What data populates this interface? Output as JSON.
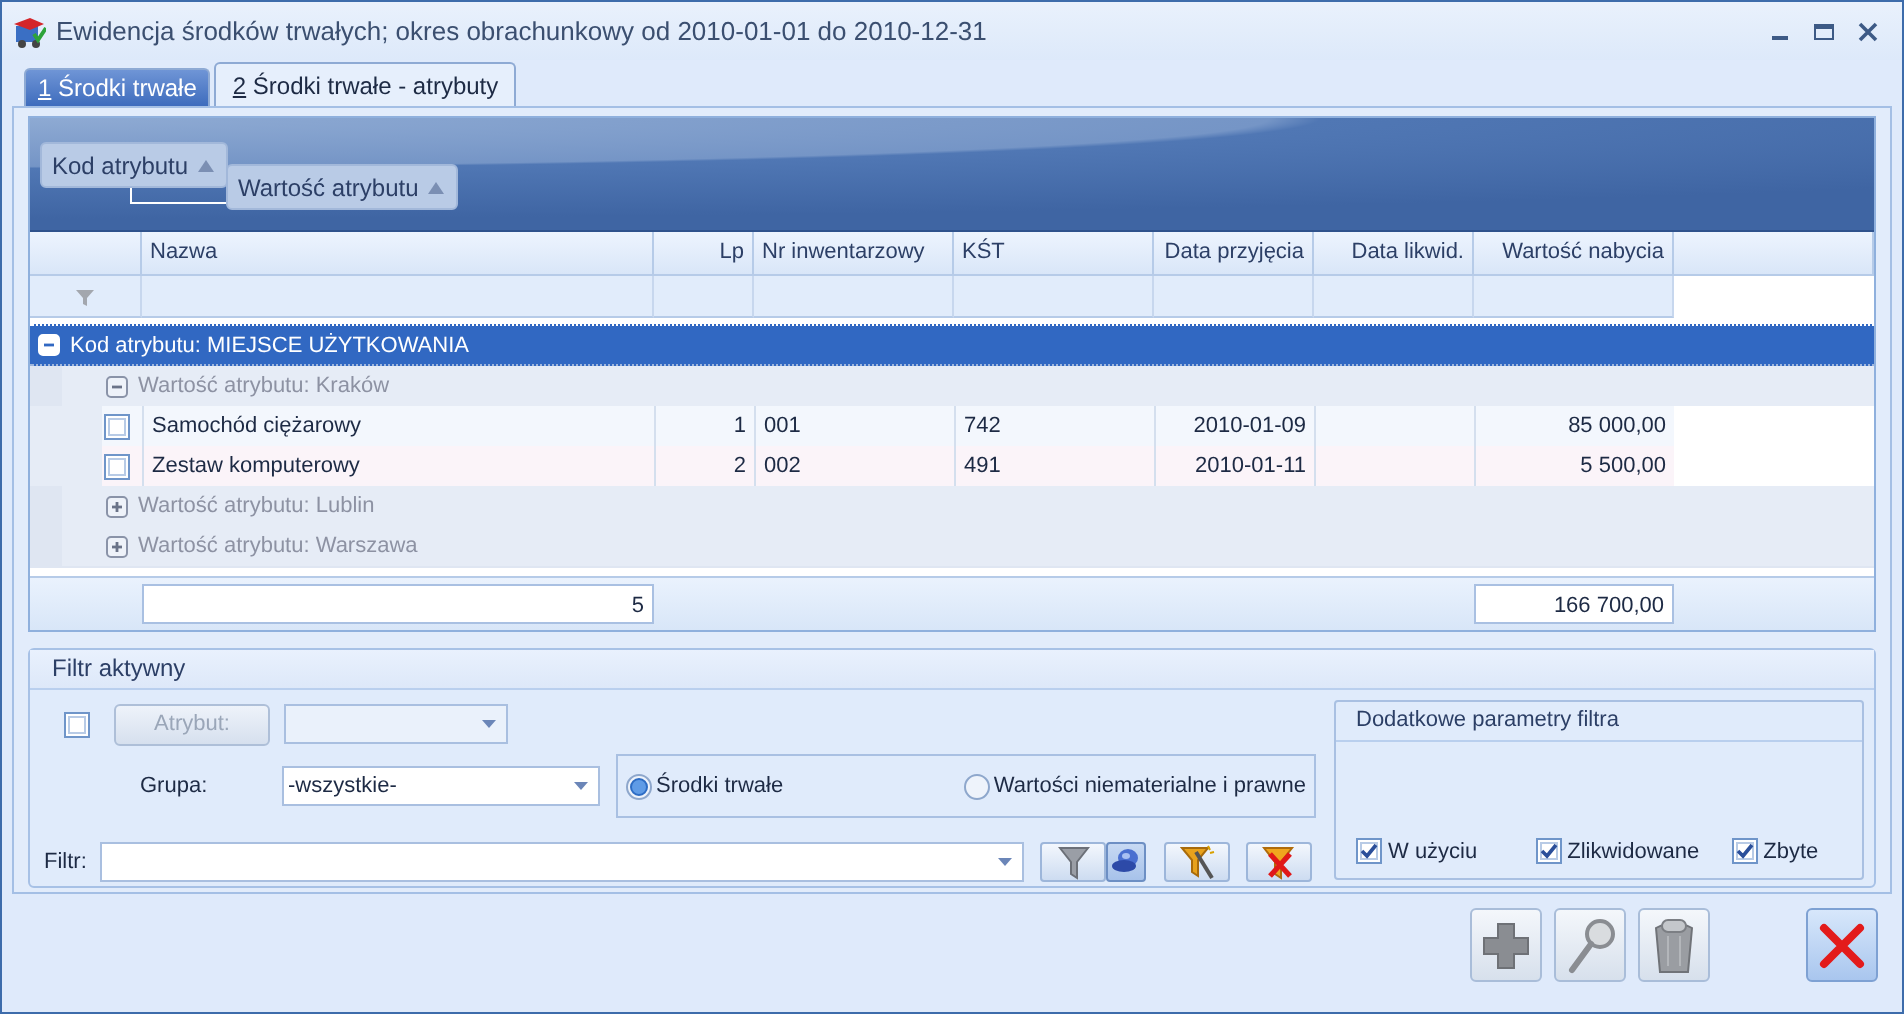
{
  "window": {
    "title": "Ewidencja środków trwałych; okres obrachunkowy od 2010-01-01 do 2010-12-31"
  },
  "tabs": [
    {
      "hotkey": "1",
      "label": " Środki trwałe",
      "selected": false
    },
    {
      "hotkey": "2",
      "label": " Środki trwałe - atrybuty",
      "selected": true
    }
  ],
  "group_by": [
    {
      "label": "Kod atrybutu"
    },
    {
      "label": "Wartość atrybutu"
    }
  ],
  "table": {
    "columns": [
      {
        "label": "Nazwa"
      },
      {
        "label": "Lp"
      },
      {
        "label": "Nr inwentarzowy"
      },
      {
        "label": "KŚT"
      },
      {
        "label": "Data przyjęcia"
      },
      {
        "label": "Data likwid."
      },
      {
        "label": "Wartość nabycia"
      }
    ],
    "groups": [
      {
        "label": "Kod atrybutu: MIEJSCE UŻYTKOWANIA",
        "expanded": true,
        "selected": true,
        "children": [
          {
            "label": "Wartość atrybutu: Kraków",
            "expanded": true,
            "rows": [
              {
                "checked": false,
                "cells": [
                  "Samochód ciężarowy",
                  "1",
                  "001",
                  "742",
                  "2010-01-09",
                  null,
                  "85 000,00"
                ]
              },
              {
                "checked": false,
                "cells": [
                  "Zestaw komputerowy",
                  "2",
                  "002",
                  "491",
                  "2010-01-11",
                  null,
                  "5 500,00"
                ]
              }
            ]
          },
          {
            "label": "Wartość atrybutu: Lublin",
            "expanded": false
          },
          {
            "label": "Wartość atrybutu: Warszawa",
            "expanded": false
          }
        ]
      }
    ],
    "footer": {
      "count": "5",
      "total": "166 700,00"
    }
  },
  "filter": {
    "title": "Filtr aktywny",
    "attribute_checked": false,
    "attribute_button": "Atrybut:",
    "attribute_disabled": true,
    "group_label": "Grupa:",
    "group_value": "-wszystkie-",
    "kinds": [
      {
        "label": "Środki trwałe",
        "selected": true
      },
      {
        "label": "Wartości niematerialne i prawne",
        "selected": false
      }
    ],
    "filter_label": "Filtr:",
    "tools": [
      {
        "kind": "funnel",
        "pressed": false
      },
      {
        "kind": "pin",
        "pressed": true
      },
      {
        "kind": "funnel-wand",
        "pressed": false
      },
      {
        "kind": "funnel-clear",
        "pressed": false
      }
    ],
    "extra": {
      "title": "Dodatkowe parametry filtra",
      "options": [
        {
          "label": "W użyciu",
          "checked": true
        },
        {
          "label": "Zlikwidowane",
          "checked": true
        },
        {
          "label": "Zbyte",
          "checked": true
        }
      ]
    }
  },
  "actions": [
    {
      "kind": "add",
      "disabled": true
    },
    {
      "kind": "view",
      "disabled": true
    },
    {
      "kind": "delete",
      "disabled": true
    },
    {
      "kind": "close",
      "disabled": false
    }
  ]
}
